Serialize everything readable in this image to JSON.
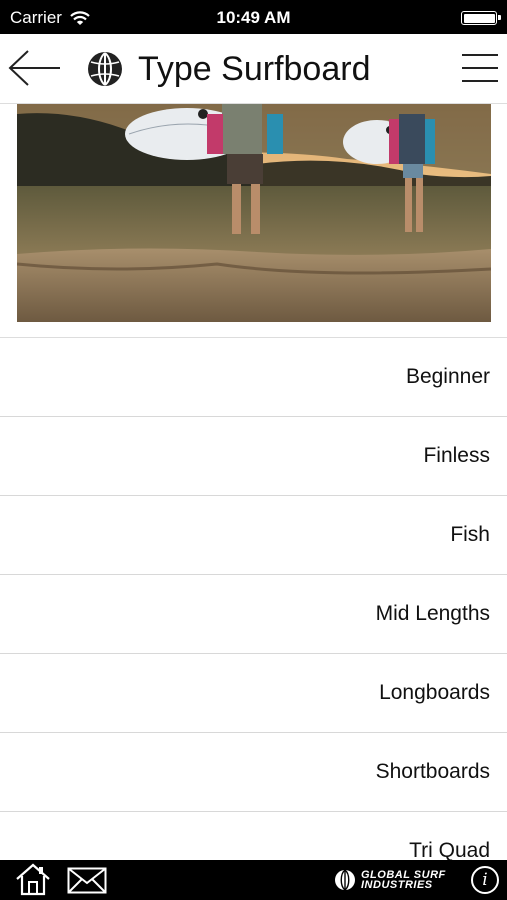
{
  "status_bar": {
    "carrier": "Carrier",
    "time": "10:49 AM",
    "wifi_icon": "wifi-icon",
    "battery_icon": "battery-icon"
  },
  "header": {
    "title": "Type Surfboard",
    "back_icon": "back-arrow-icon",
    "logo_icon": "globe-logo-icon",
    "menu_icon": "hamburger-menu-icon"
  },
  "hero": {
    "image": "surfers-on-dunes-photo"
  },
  "list": {
    "items": [
      {
        "label": "Beginner"
      },
      {
        "label": "Finless"
      },
      {
        "label": "Fish"
      },
      {
        "label": "Mid Lengths"
      },
      {
        "label": "Longboards"
      },
      {
        "label": "Shortboards"
      },
      {
        "label": "Tri Quad"
      }
    ]
  },
  "toolbar": {
    "home_icon": "home-icon",
    "mail_icon": "mail-icon",
    "brand_line1": "GLOBAL SURF",
    "brand_line2": "INDUSTRIES",
    "info_label": "i"
  },
  "colors": {
    "bar_background": "#000000",
    "text": "#111111",
    "divider": "#d8d8d8"
  }
}
